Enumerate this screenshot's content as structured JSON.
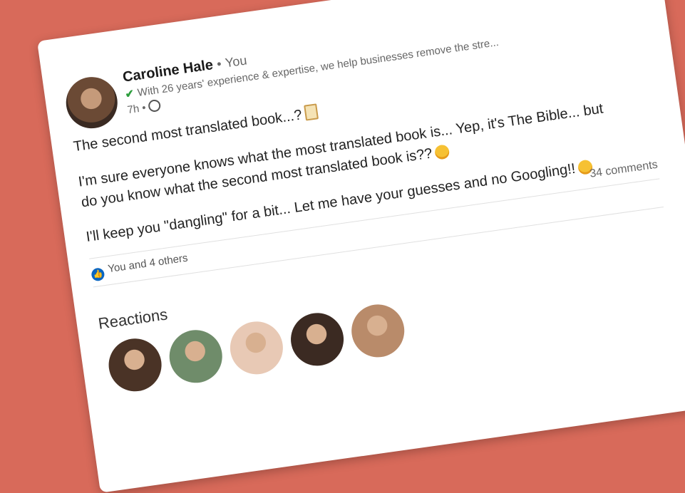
{
  "post": {
    "author_name": "Caroline Hale",
    "separator": "•",
    "relation": "You",
    "headline": "With 26 years' experience & expertise, we help businesses remove the stre...",
    "time": "7h •",
    "paragraph1": "The second most translated book...?",
    "paragraph2_line1": "I'm sure everyone knows what the most translated book is... Yep, it's The Bible... but",
    "paragraph2_line2": "do you know what the second most translated book is??",
    "paragraph3": "I'll keep you \"dangling\" for a bit... Let me have your guesses and no Googling!!",
    "comments_count": "34 comments",
    "reactions_summary": "You and 4 others",
    "more_label": "···"
  },
  "reactions_section": {
    "title": "Reactions",
    "avatars": [
      {
        "name": "reactor-avatar-1",
        "color": "#4a3326"
      },
      {
        "name": "reactor-avatar-2",
        "color": "#6f8c6a"
      },
      {
        "name": "reactor-avatar-3",
        "color": "#e8c9b5"
      },
      {
        "name": "reactor-avatar-4",
        "color": "#3b2a22"
      },
      {
        "name": "reactor-avatar-5",
        "color": "#b98b6a"
      }
    ]
  },
  "colors": {
    "background": "#d86a5a",
    "card": "#ffffff",
    "like_blue": "#0a66c2",
    "verified_green": "#2e9e3e"
  }
}
